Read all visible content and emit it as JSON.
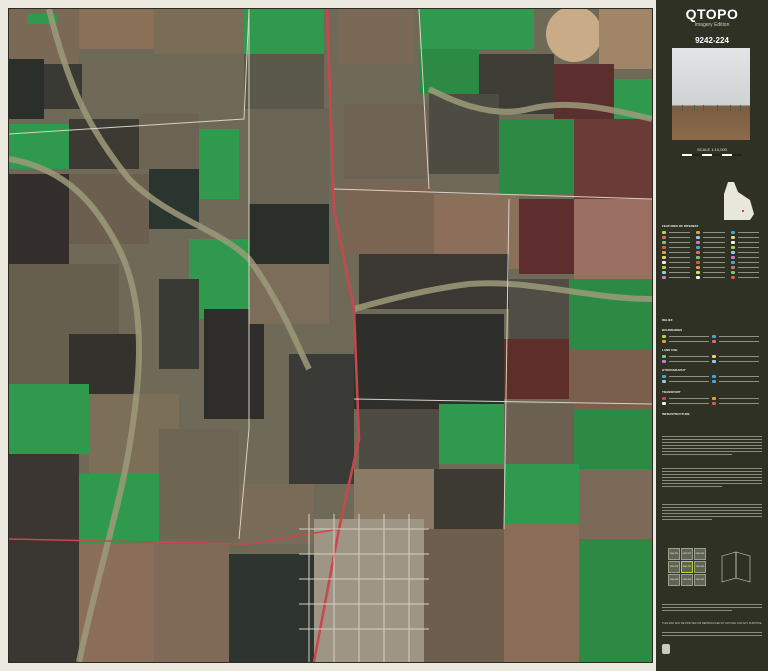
{
  "panel": {
    "title": "QTOPO",
    "edition": "Imagery Edition",
    "sheet_number": "9242-224",
    "scale": "SCALE 1:10,000",
    "sections": {
      "features": "FEATURES OF INTEREST",
      "relief": "RELIEF",
      "boundaries": "BOUNDARIES",
      "land_use": "LAND USE",
      "hydrography": "HYDROGRAPHY",
      "transport": "TRANSPORT",
      "infrastructure": "INFRASTRUCTURE"
    },
    "grid_sheets": [
      "9242-221",
      "9242-222",
      "9242-223",
      "9242-224",
      "9242-231",
      "9242-232",
      "9242-233",
      "9242-234",
      "9242-241"
    ],
    "footer": "THIS MAP MAY BE PRINTED OR REPRODUCED BY ANYONE FOR ANY PURPOSE",
    "colors": {
      "panel": "#2e3123",
      "accent": "#b5d241",
      "water": "#46a6d8",
      "road": "#c9474c",
      "field_green": "#2f9a4e",
      "fallow": "#8b7058",
      "dark_field": "#3a3a34",
      "creek": "#9d9a7a"
    }
  }
}
